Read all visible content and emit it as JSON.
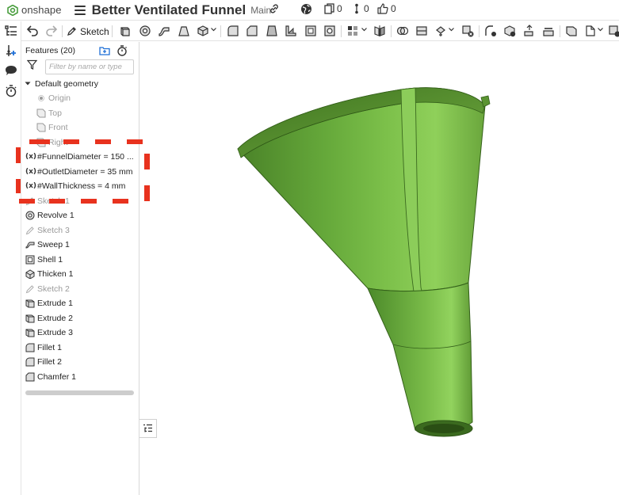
{
  "app": {
    "brand": "onshape",
    "document_title": "Better Ventilated Funnel",
    "branch": "Main",
    "counts": {
      "versions": "0",
      "branches": "0",
      "likes": "0"
    },
    "brand_color": "#4a9e3f"
  },
  "toolbar": {
    "sketch_label": "Sketch"
  },
  "feature_panel": {
    "header": "Features (20)",
    "filter_placeholder": "Filter by name or type",
    "items": [
      {
        "label": "Default geometry",
        "icon": "caret-down-icon"
      },
      {
        "label": "Origin",
        "icon": "origin-icon",
        "dim": true
      },
      {
        "label": "Top",
        "icon": "plane-icon",
        "dim": true
      },
      {
        "label": "Front",
        "icon": "plane-icon",
        "dim": true
      },
      {
        "label": "Right",
        "icon": "plane-icon",
        "dim": true
      },
      {
        "label": "#FunnelDiameter = 150 ...",
        "icon": "variable-icon"
      },
      {
        "label": "#OutletDiameter = 35 mm",
        "icon": "variable-icon"
      },
      {
        "label": "#WallThickness = 4 mm",
        "icon": "variable-icon"
      },
      {
        "label": "Sketch 1",
        "icon": "sketch-icon",
        "dim": true
      },
      {
        "label": "Revolve 1",
        "icon": "revolve-icon"
      },
      {
        "label": "Sketch 3",
        "icon": "sketch-icon",
        "dim": true
      },
      {
        "label": "Sweep 1",
        "icon": "sweep-icon"
      },
      {
        "label": "Shell 1",
        "icon": "shell-icon"
      },
      {
        "label": "Thicken 1",
        "icon": "thicken-icon"
      },
      {
        "label": "Sketch 2",
        "icon": "sketch-icon",
        "dim": true
      },
      {
        "label": "Extrude 1",
        "icon": "extrude-icon"
      },
      {
        "label": "Extrude 2",
        "icon": "extrude-icon"
      },
      {
        "label": "Extrude 3",
        "icon": "extrude-icon"
      },
      {
        "label": "Fillet 1",
        "icon": "fillet-icon"
      },
      {
        "label": "Fillet 2",
        "icon": "fillet-icon"
      },
      {
        "label": "Chamfer 1",
        "icon": "chamfer-icon"
      }
    ]
  },
  "model": {
    "color": "#5c9a33",
    "annotation_color": "#e8321e"
  }
}
